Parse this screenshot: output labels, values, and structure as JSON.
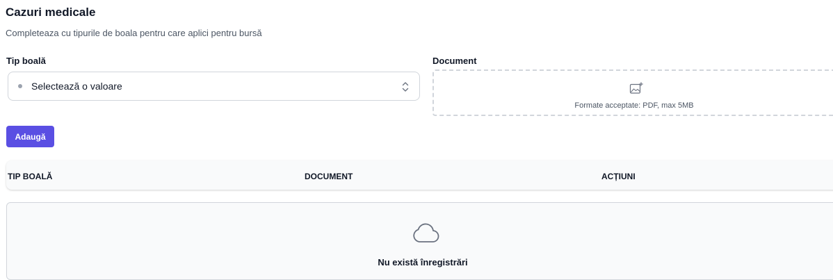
{
  "section": {
    "title": "Cazuri medicale",
    "subtitle": "Completeaza cu tipurile de boala pentru care aplici pentru bursă"
  },
  "form": {
    "type_label": "Tip boală",
    "type_select": {
      "value": "Selectează o valoare",
      "icon": "chevron-up-down-icon"
    },
    "document_label": "Document",
    "document_dropzone": {
      "hint": "Formate acceptate: PDF, max 5MB",
      "icon": "image-add-icon"
    },
    "add_button_label": "Adaugă"
  },
  "table": {
    "columns": [
      "TIP BOALĂ",
      "DOCUMENT",
      "ACȚIUNI"
    ],
    "empty_state": {
      "icon": "cloud-icon",
      "text": "Nu există înregistrări"
    }
  },
  "colors": {
    "accent": "#5a4fe3",
    "border": "#d1d5db",
    "muted_text": "#4b5563",
    "panel_bg": "#f9fafb"
  }
}
